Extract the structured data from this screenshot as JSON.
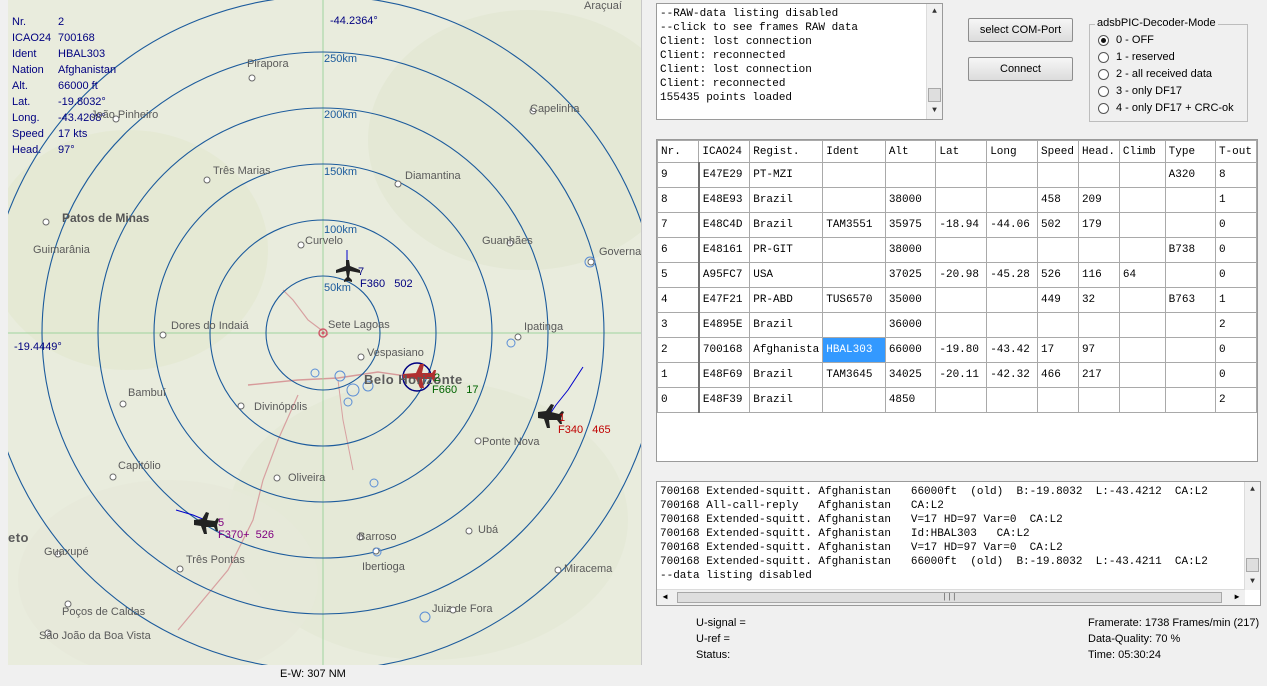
{
  "info": {
    "rows": [
      {
        "k": "Nr.",
        "v": "2"
      },
      {
        "k": "ICAO24",
        "v": "700168"
      },
      {
        "k": "Ident",
        "v": "HBAL303"
      },
      {
        "k": "Nation",
        "v": "Afghanistan"
      },
      {
        "k": "Alt.",
        "v": "66000 ft"
      },
      {
        "k": "Lat.",
        "v": "-19.8032°"
      },
      {
        "k": "Long.",
        "v": "-43.4208°"
      },
      {
        "k": "Speed",
        "v": "17 kts"
      },
      {
        "k": "Head.",
        "v": "97°"
      }
    ]
  },
  "map": {
    "top_coord": "-44.2364°",
    "left_coord": "-19.4449°",
    "ring_labels": [
      "50km",
      "100km",
      "150km",
      "200km",
      "250km"
    ],
    "ew_scale": "E-W: 307 NM",
    "cities": [
      "Araçuaí",
      "Pirapora",
      "João Pinheiro",
      "Capelinha",
      "Três Marias",
      "Diamantina",
      "Patos de Minas",
      "Curvelo",
      "Guanhães",
      "Governa",
      "Guimarânia",
      "Dores do Indaiá",
      "Sete Lagoas",
      "Ipatinga",
      "Vespasiano",
      "Belo Horizonte",
      "Bambuí",
      "Divinópolis",
      "Ponte Nova",
      "Capitólio",
      "Oliveira",
      "eto",
      "Barroso",
      "Ubá",
      "Guaxupé",
      "Três Pontas",
      "Ibertioga",
      "Miracema",
      "Poços de Caldas",
      "Juiz de Fora",
      "São João da Boa Vista"
    ],
    "aircraft": [
      {
        "nr": "7",
        "label": "F360",
        "speed": "502",
        "color": "#000080"
      },
      {
        "nr": "2",
        "label": "F660",
        "speed": "17",
        "color": "#006400"
      },
      {
        "nr": "1",
        "label": "F340",
        "speed": "465",
        "color": "#c00000"
      },
      {
        "nr": "5",
        "label": "F370+",
        "speed": "526",
        "color": "#800080"
      }
    ]
  },
  "raw": {
    "lines": [
      "--RAW-data listing disabled",
      "--click to see frames RAW data",
      "Client: lost connection",
      "Client: reconnected",
      "Client: lost connection",
      "Client: reconnected",
      "155435 points loaded"
    ]
  },
  "buttons": {
    "select_com": "select COM-Port",
    "connect": "Connect"
  },
  "decoder_mode": {
    "title": "adsbPIC-Decoder-Mode",
    "options": [
      "0 - OFF",
      "1 - reserved",
      "2 - all received data",
      "3 - only DF17",
      "4 - only DF17 + CRC-ok"
    ],
    "selected_index": 0
  },
  "table": {
    "headers": [
      "Nr.",
      "ICAO24",
      "Regist.",
      "Ident",
      "Alt",
      "Lat",
      "Long",
      "Speed",
      "Head.",
      "Climb",
      "Type",
      "T-out"
    ],
    "rows": [
      [
        "9",
        "E47E29",
        "PT-MZI",
        "",
        "",
        "",
        "",
        "",
        "",
        "",
        "A320",
        "8"
      ],
      [
        "8",
        "E48E93",
        "Brazil",
        "",
        "38000",
        "",
        "",
        "458",
        "209",
        "",
        "",
        "1"
      ],
      [
        "7",
        "E48C4D",
        "Brazil",
        "TAM3551",
        "35975",
        "-18.94",
        "-44.06",
        "502",
        "179",
        "",
        "",
        "0"
      ],
      [
        "6",
        "E48161",
        "PR-GIT",
        "",
        "38000",
        "",
        "",
        "",
        "",
        "",
        "B738",
        "0"
      ],
      [
        "5",
        "A95FC7",
        "USA",
        "",
        "37025",
        "-20.98",
        "-45.28",
        "526",
        "116",
        "64",
        "",
        "0"
      ],
      [
        "4",
        "E47F21",
        "PR-ABD",
        "TUS6570",
        "35000",
        "",
        "",
        "449",
        "32",
        "",
        "B763",
        "1"
      ],
      [
        "3",
        "E4895E",
        "Brazil",
        "",
        "36000",
        "",
        "",
        "",
        "",
        "",
        "",
        "2"
      ],
      [
        "2",
        "700168",
        "Afghanista",
        "HBAL303",
        "66000",
        "-19.80",
        "-43.42",
        "17",
        "97",
        "",
        "",
        "0"
      ],
      [
        "1",
        "E48F69",
        "Brazil",
        "TAM3645",
        "34025",
        "-20.11",
        "-42.32",
        "466",
        "217",
        "",
        "",
        "0"
      ],
      [
        "0",
        "E48F39",
        "Brazil",
        "",
        "4850",
        "",
        "",
        "",
        "",
        "",
        "",
        "2"
      ]
    ],
    "selected_cell": "HBAL303"
  },
  "log": {
    "lines": [
      "700168 Extended-squitt. Afghanistan   66000ft  (old)  B:-19.8032  L:-43.4212  CA:L2",
      "700168 All-call-reply   Afghanistan   CA:L2",
      "700168 Extended-squitt. Afghanistan   V=17 HD=97 Var=0  CA:L2",
      "700168 Extended-squitt. Afghanistan   Id:HBAL303   CA:L2",
      "700168 Extended-squitt. Afghanistan   V=17 HD=97 Var=0  CA:L2",
      "700168 Extended-squitt. Afghanistan   66000ft  (old)  B:-19.8032  L:-43.4211  CA:L2",
      "--data listing disabled"
    ]
  },
  "status": {
    "u_signal": "U-signal =",
    "u_ref": "U-ref =",
    "status": "Status:",
    "framerate": "Framerate:  1738 Frames/min (217)",
    "quality": "Data-Quality: 70 %",
    "time": "Time: 05:30:24"
  }
}
